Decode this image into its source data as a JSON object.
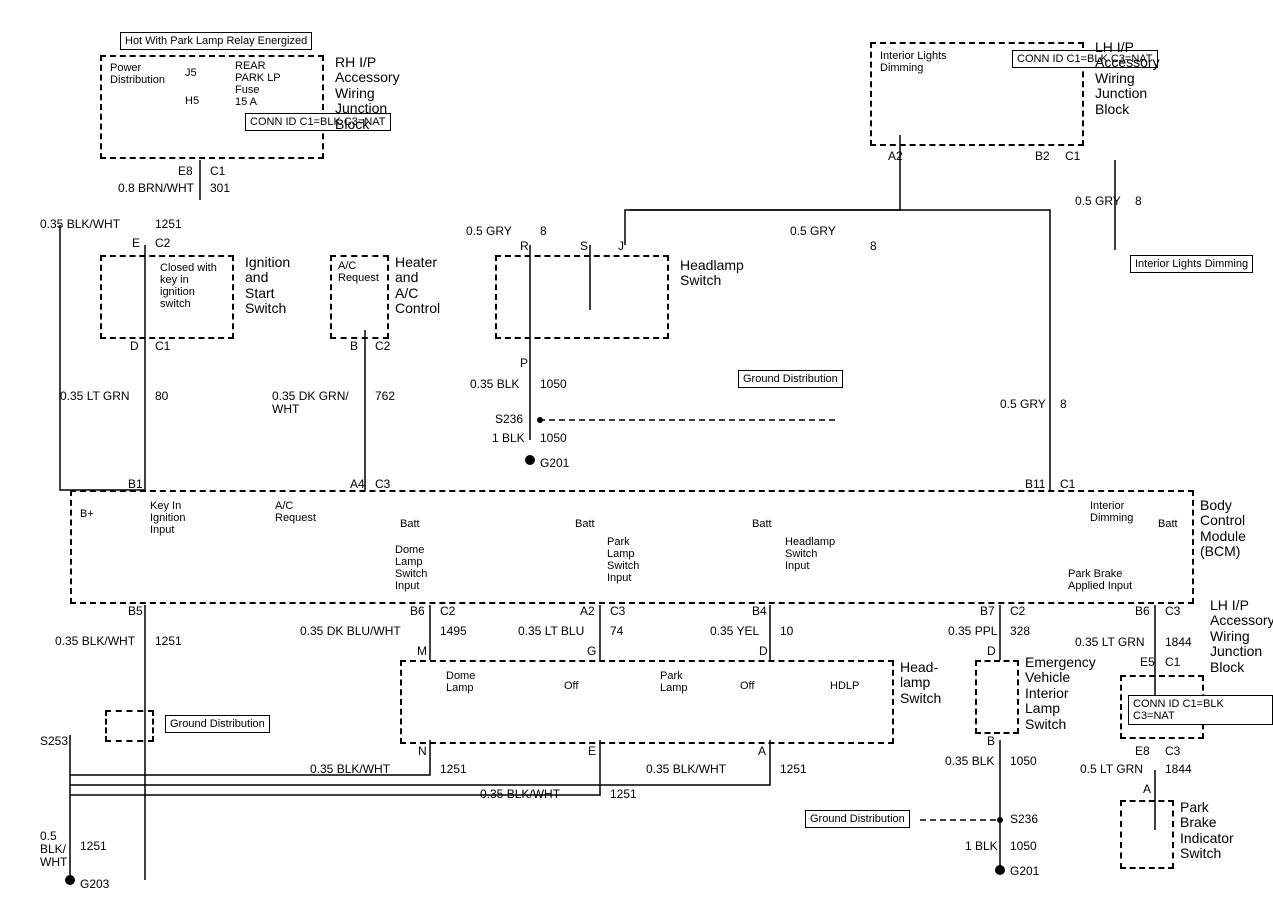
{
  "header": {
    "hot_with": "Hot With Park Lamp Relay Energized"
  },
  "blocks": {
    "rh_ip": {
      "label": "RH I/P\nAccessory\nWiring\nJunction\nBlock",
      "conn_id": "CONN ID\nC1=BLK\nC3=NAT",
      "power_dist": "Power\nDistribution",
      "j5": "J5",
      "h5": "H5",
      "rear_park": "REAR\nPARK LP\nFuse\n15 A"
    },
    "lh_ip_top": {
      "label": "LH I/P\nAccessory\nWiring\nJunction\nBlock",
      "conn_id": "CONN ID\nC1=BLK\nC3=NAT",
      "interior_dim": "Interior Lights\nDimming"
    },
    "lh_ip_bottom": {
      "label": "LH I/P\nAccessory\nWiring\nJunction\nBlock",
      "conn_id": "CONN ID\nC1=BLK\nC3=NAT"
    },
    "ignition": {
      "label": "Ignition\nand\nStart\nSwitch",
      "note": "Closed with\nkey in\nignition\nswitch"
    },
    "heater": {
      "label": "Heater\nand\nA/C\nControl",
      "note": "A/C\nRequest"
    },
    "headlamp_switch_top": {
      "label": "Headlamp\nSwitch"
    },
    "headlamp_switch_bottom": {
      "label": "Head-\nlamp\nSwitch",
      "dome": "Dome\nLamp",
      "park": "Park\nLamp",
      "hdlp": "HDLP",
      "off1": "Off",
      "off2": "Off"
    },
    "bcm": {
      "label": "Body\nControl\nModule\n(BCM)",
      "key_in": "Key In\nIgnition\nInput",
      "b_plus": "B+",
      "ac_req": "A/C\nRequest",
      "batt": "Batt",
      "dome_sw": "Dome\nLamp\nSwitch\nInput",
      "park_sw": "Park\nLamp\nSwitch\nInput",
      "head_sw": "Headlamp\nSwitch\nInput",
      "int_dim": "Interior\nDimming",
      "park_brake": "Park Brake\nApplied Input"
    },
    "emergency": {
      "label": "Emergency\nVehicle\nInterior\nLamp\nSwitch"
    },
    "park_brake_ind": {
      "label": "Park\nBrake\nIndicator\nSwitch"
    },
    "interior_lights_dim_box": {
      "label": "Interior\nLights\nDimming"
    },
    "gnd_dist": "Ground Distribution"
  },
  "pins_wires": {
    "e8": "E8",
    "c1_301": "C1",
    "w_08_brnwht": "0.8 BRN/WHT",
    "n_301": "301",
    "w_035_blkwht": "0.35 BLK/WHT",
    "n_1251": "1251",
    "e": "E",
    "c2": "C2",
    "d": "D",
    "c1_80": "C1",
    "w_035_ltgrn": "0.35 LT GRN",
    "n_80": "80",
    "b1": "B1",
    "b5": "B5",
    "b": "B",
    "c2_762": "C2",
    "w_035_dkgrnwht": "0.35 DK GRN/\nWHT",
    "n_762": "762",
    "a4": "A4",
    "c3": "C3",
    "r": "R",
    "s": "S",
    "j": "J",
    "p": "P",
    "w_05_gry": "0.5 GRY",
    "n_8": "8",
    "w_035_blk": "0.35 BLK",
    "n_1050": "1050",
    "s236": "S236",
    "w_1_blk": "1 BLK",
    "g201": "G201",
    "a2": "A2",
    "b2": "B2",
    "c1_b2": "C1",
    "b11": "B11",
    "c1_b11": "C1",
    "b6": "B6",
    "c2_1495": "C2",
    "w_035_dkbluwht": "0.35 DK BLU/WHT",
    "n_1495": "1495",
    "m": "M",
    "a2_c3": "A2",
    "c3_74": "C3",
    "w_035_ltblu": "0.35 LT BLU",
    "n_74": "74",
    "g": "G",
    "b4": "B4",
    "w_035_yel": "0.35 YEL",
    "n_10": "10",
    "d_head": "D",
    "b7": "B7",
    "c2_328": "C2",
    "w_035_ppl": "0.35 PPL",
    "n_328": "328",
    "d_emerg": "D",
    "b6_c3": "B6",
    "c3_1844": "C3",
    "w_035_ltgrn_1844": "0.35 LT GRN",
    "n_1844": "1844",
    "e5": "E5",
    "c1_e5": "C1",
    "e8_c3": "E8",
    "c3_e8": "C3",
    "w_05_ltgrn": "0.5 LT GRN",
    "a": "A",
    "n_line": "N",
    "e_line": "E",
    "a_line": "A",
    "b_emerg": "B",
    "w_035_blk_emerg": "0.35 BLK",
    "s253": "S253",
    "w_05_blkwht": "0.5\nBLK/\nWHT",
    "g203": "G203"
  }
}
